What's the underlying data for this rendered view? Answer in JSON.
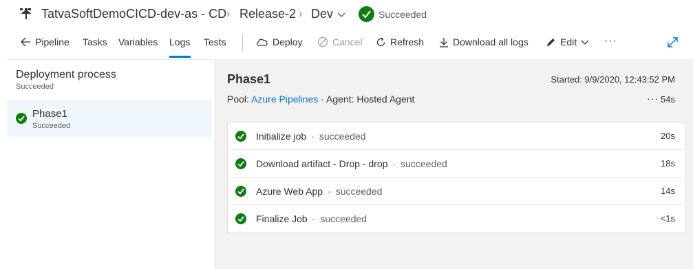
{
  "header": {
    "breadcrumbs": [
      "TatvaSoftDemoCICD-dev-as - CD",
      "Release-2",
      "Dev"
    ],
    "status": "Succeeded",
    "colors": {
      "success": "#107c10",
      "accent": "#0078d4"
    }
  },
  "toolbar": {
    "back_label": "Pipeline",
    "tabs": [
      "Tasks",
      "Variables",
      "Logs",
      "Tests"
    ],
    "active_tab": "Logs",
    "deploy_label": "Deploy",
    "cancel_label": "Cancel",
    "refresh_label": "Refresh",
    "download_label": "Download all logs",
    "edit_label": "Edit",
    "more_label": "···"
  },
  "left": {
    "title": "Deployment process",
    "subtitle": "Succeeded",
    "phase": {
      "name": "Phase1",
      "status": "Succeeded"
    }
  },
  "main": {
    "title": "Phase1",
    "started": "Started: 9/9/2020, 12:43:52 PM",
    "pool_label": "Pool:",
    "pool_link": "Azure Pipelines",
    "agent": "· Agent: Hosted Agent",
    "more": "···",
    "duration": "54s",
    "steps": [
      {
        "name": "Initialize job",
        "status": "succeeded",
        "duration": "20s"
      },
      {
        "name": "Download artifact - Drop - drop",
        "status": "succeeded",
        "duration": "18s"
      },
      {
        "name": "Azure Web App",
        "status": "succeeded",
        "duration": "14s"
      },
      {
        "name": "Finalize Job",
        "status": "succeeded",
        "duration": "<1s"
      }
    ]
  }
}
